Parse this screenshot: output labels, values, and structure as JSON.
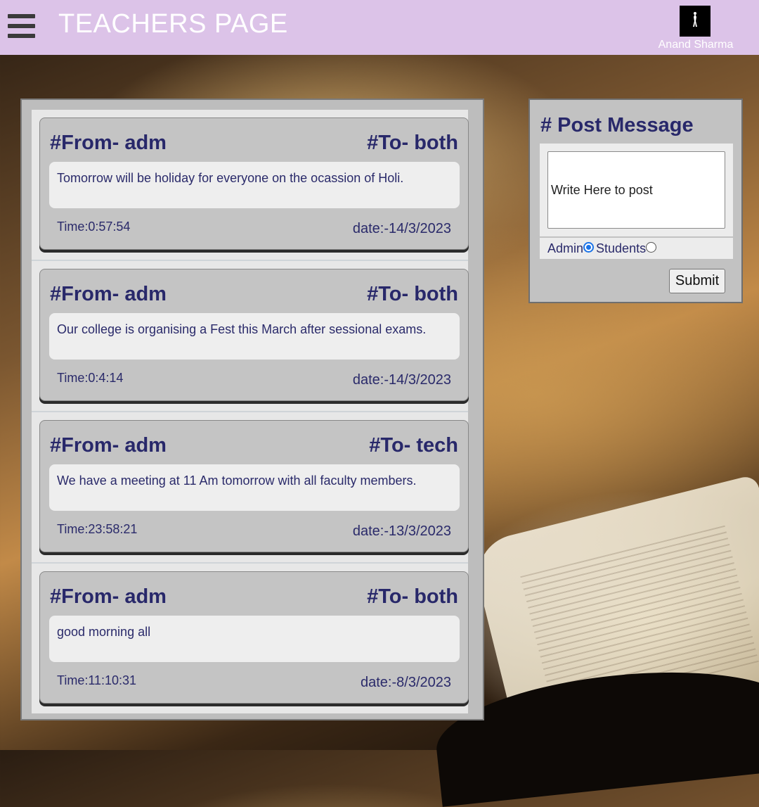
{
  "header": {
    "title": "TEACHERS PAGE",
    "user_name": "Anand Sharma",
    "avatar_icon": "user-avatar-icon",
    "menu_icon": "hamburger-menu-icon"
  },
  "messages": [
    {
      "from": "#From- adm",
      "to": "#To- both",
      "text": "Tomorrow will be holiday for everyone on the ocassion of Holi.",
      "time": "Time:0:57:54",
      "date": "date:-14/3/2023"
    },
    {
      "from": "#From- adm",
      "to": "#To- both",
      "text": "Our college is organising a Fest this March after sessional exams.",
      "time": "Time:0:4:14",
      "date": "date:-14/3/2023"
    },
    {
      "from": "#From- adm",
      "to": "#To- tech",
      "text": "We have a meeting at 11 Am tomorrow with all faculty members.",
      "time": "Time:23:58:21",
      "date": "date:-13/3/2023"
    },
    {
      "from": "#From- adm",
      "to": "#To- both",
      "text": "good morning all",
      "time": "Time:11:10:31",
      "date": "date:-8/3/2023"
    }
  ],
  "post": {
    "title": "# Post Message",
    "placeholder": "Write Here to post",
    "options": [
      {
        "label": "Admin",
        "selected": true
      },
      {
        "label": "Students",
        "selected": false
      }
    ],
    "submit_label": "Submit"
  },
  "colors": {
    "header_bg": "#dcc3e8",
    "accent_text": "#28286a"
  }
}
